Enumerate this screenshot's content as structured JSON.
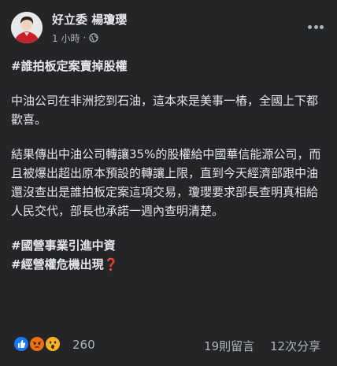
{
  "post": {
    "author": "好立委 楊瓊瓔",
    "time": "1 小時",
    "separator": "·",
    "privacy_icon": "globe-icon",
    "title_tag": "#誰拍板定案賣掉股權",
    "paragraphs": [
      "中油公司在非洲挖到石油，這本來是美事一樁，全國上下都歡喜。",
      "結果傳出中油公司轉讓35%的股權給中國華信能源公司，而且被爆出超出原本預設的轉讓上限，直到今天經濟部跟中油還沒查出是誰拍板定案這項交易，瓊瓔要求部長查明真相給人民交代，部長也承諾一週內查明清楚。"
    ],
    "hashtags": [
      "#國營事業引進中資",
      "#經營權危機出現"
    ],
    "hashtag_emoji": "❓"
  },
  "engagement": {
    "reaction_icons": [
      "like-icon",
      "angry-icon",
      "wow-icon"
    ],
    "reaction_count": "260",
    "comments": "19則留言",
    "shares": "12次分享"
  },
  "colors": {
    "background": "#242526",
    "text": "#e4e6eb",
    "secondary": "#b0b3b8",
    "like": "#1877f2",
    "angry": "#e9710f",
    "wow": "#f7b125"
  }
}
